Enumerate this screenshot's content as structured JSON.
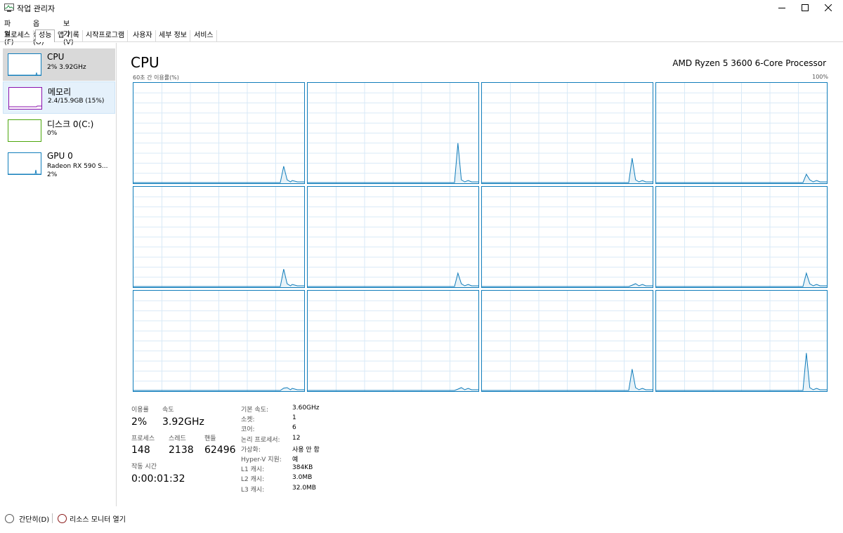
{
  "window": {
    "title": "작업 관리자"
  },
  "menu": [
    "파일(F)",
    "옵션(O)",
    "보기(V)"
  ],
  "tabs": [
    {
      "label": "프로세스",
      "active": false
    },
    {
      "label": "성능",
      "active": true
    },
    {
      "label": "앱 기록",
      "active": false
    },
    {
      "label": "시작프로그램",
      "active": false
    },
    {
      "label": "사용자",
      "active": false
    },
    {
      "label": "세부 정보",
      "active": false
    },
    {
      "label": "서비스",
      "active": false
    }
  ],
  "sidebar": {
    "items": [
      {
        "name": "CPU",
        "line1": "2% 3.92GHz",
        "line2": "",
        "color": "#117dbb",
        "usage_percent": 2
      },
      {
        "name": "메모리",
        "line1": "2.4/15.9GB (15%)",
        "line2": "",
        "color": "#8b12ae",
        "usage_percent": 15
      },
      {
        "name": "디스크 0(C:)",
        "line1": "0%",
        "line2": "",
        "color": "#4da60c",
        "usage_percent": 0
      },
      {
        "name": "GPU 0",
        "line1": "Radeon RX 590 S...",
        "line2": "2%",
        "color": "#117dbb",
        "usage_percent": 2
      }
    ]
  },
  "main": {
    "title": "CPU",
    "model": "AMD Ryzen 5 3600 6-Core Processor",
    "graph_caption": "60초 간 이용률(%)",
    "graph_max": "100%",
    "graph_color": "#117dbb",
    "cores_usage_peaks": [
      17,
      40,
      25,
      9,
      18,
      14,
      2,
      14,
      3,
      2,
      22,
      38
    ],
    "stats": {
      "utilization_label": "이용률",
      "utilization_value": "2%",
      "speed_label": "속도",
      "speed_value": "3.92GHz",
      "processes_label": "프로세스",
      "processes_value": "148",
      "threads_label": "스레드",
      "threads_value": "2138",
      "handles_label": "핸들",
      "handles_value": "62496",
      "uptime_label": "작동 시간",
      "uptime_value": "0:00:01:32"
    },
    "details": [
      {
        "key": "기본 속도:",
        "value": "3.60GHz"
      },
      {
        "key": "소켓:",
        "value": "1"
      },
      {
        "key": "코어:",
        "value": "6"
      },
      {
        "key": "논리 프로세서:",
        "value": "12"
      },
      {
        "key": "가상화:",
        "value": "사용 안 함"
      },
      {
        "key": "Hyper-V 지원:",
        "value": "예"
      },
      {
        "key": "L1 캐시:",
        "value": "384KB"
      },
      {
        "key": "L2 캐시:",
        "value": "3.0MB"
      },
      {
        "key": "L3 캐시:",
        "value": "32.0MB"
      }
    ]
  },
  "footer": {
    "fewer_details": "간단히(D)",
    "resource_monitor": "리소스 모니터 열기"
  }
}
